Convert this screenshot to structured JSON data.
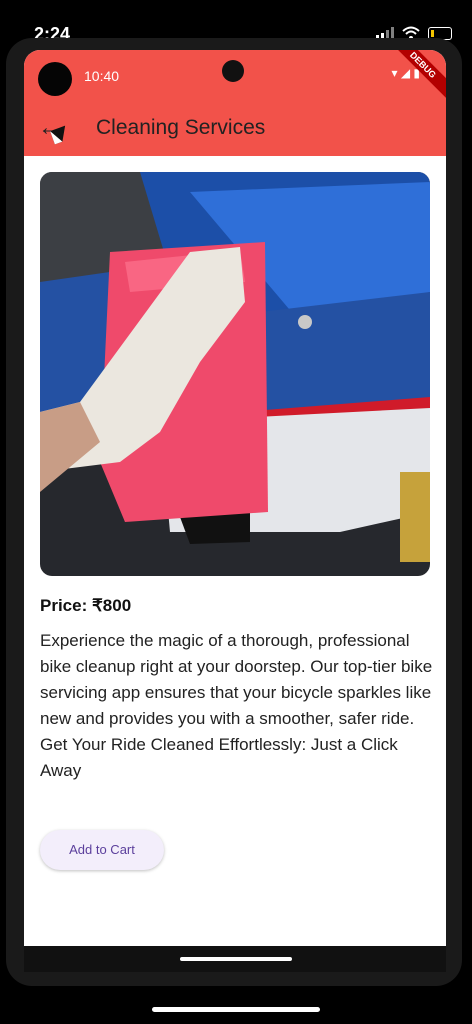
{
  "outer_status": {
    "time": "2:24"
  },
  "inner_status": {
    "time": "10:40",
    "debug_label": "DEBUG"
  },
  "app_bar": {
    "title": "Cleaning Services"
  },
  "product": {
    "price": "Price: ₹800",
    "description": "Experience the magic of a thorough, professional bike cleanup right at your doorstep. Our top-tier bike servicing app ensures that your bicycle sparkles like new and provides you with a smoother, safer ride. Get Your Ride Cleaned Effortlessly: Just a Click Away",
    "add_to_cart_label": "Add to Cart"
  },
  "colors": {
    "app_bar": "#f2524a",
    "button_text": "#5b3f9c",
    "button_bg": "#f3eefb"
  }
}
